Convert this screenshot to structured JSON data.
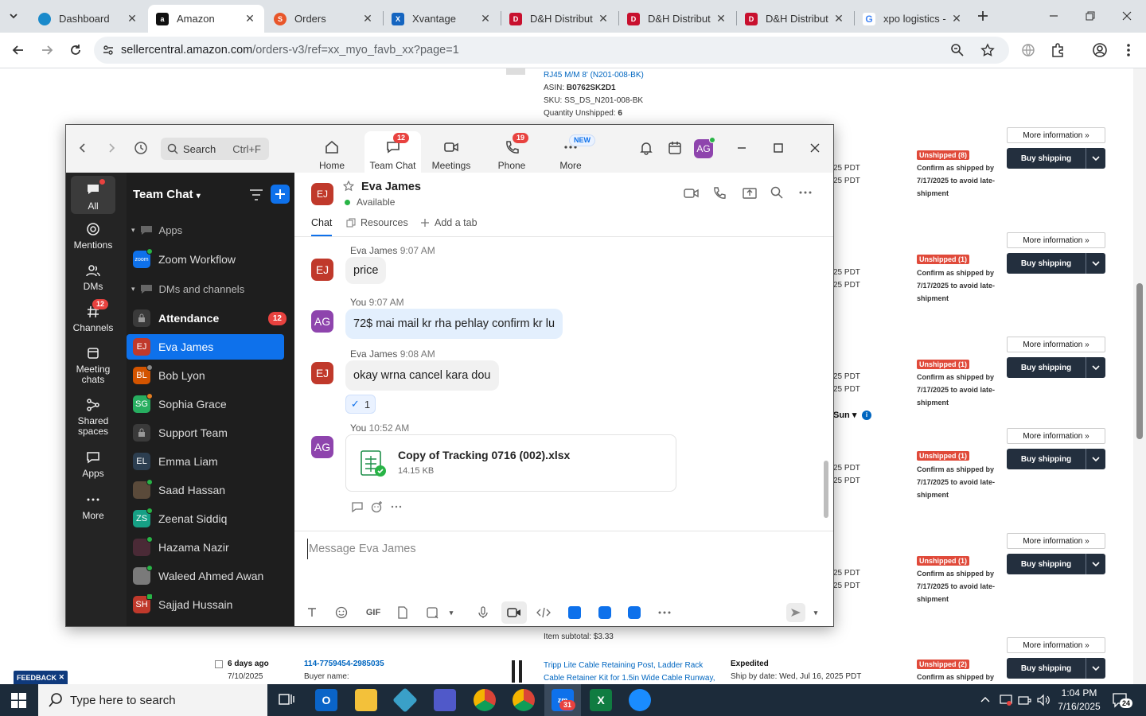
{
  "browser": {
    "tabs": [
      {
        "title": "Dashboard",
        "icon": "globe-icon"
      },
      {
        "title": "Amazon",
        "icon": "amazon-icon"
      },
      {
        "title": "Orders",
        "icon": "orders-icon"
      },
      {
        "title": "Xvantage",
        "icon": "xvantage-icon"
      },
      {
        "title": "D&H Distribut",
        "icon": "dh-icon"
      },
      {
        "title": "D&H Distribut",
        "icon": "dh-icon"
      },
      {
        "title": "D&H Distribut",
        "icon": "dh-icon"
      },
      {
        "title": "xpo logistics -",
        "icon": "google-icon"
      }
    ],
    "url_host": "sellercentral.amazon.com",
    "url_path": "/orders-v3/ref=xx_myo_favb_xx?page=1"
  },
  "page": {
    "top_item": {
      "title": "RJ45 M/M 8' (N201-008-BK)",
      "asin_label": "ASIN:",
      "asin": "B0762SK2D1",
      "sku": "SKU: SS_DS_N201-008-BK",
      "qty_label": "Quantity Unshipped:",
      "qty": "6"
    },
    "more_info": "More information »",
    "buy_shipping": "Buy shipping",
    "confirm_text": "Confirm as shipped by 7/17/2025 to avoid late-shipment",
    "pdt": "25 PDT",
    "rows": [
      {
        "status": "Unshipped (8)"
      },
      {
        "status": "Unshipped (1)"
      },
      {
        "status": "Unshipped (1)"
      },
      {
        "status": "Unshipped (1)"
      },
      {
        "status": "Unshipped (1)"
      }
    ],
    "sun_label": "Sun",
    "item_subtotal": "Item subtotal: $3.33",
    "last_row": {
      "age": "6 days ago",
      "date": "7/10/2025",
      "order_id": "114-7759454-2985035",
      "buyer_label": "Buyer name:",
      "product": "Tripp Lite Cable Retaining Post, Ladder Rack Cable Retainer Kit for 1.5in Wide Cable Runway, Straight",
      "shipping_type": "Expedited",
      "ship_by": "Ship by date: Wed, Jul 16, 2025 PDT",
      "status": "Unshipped (2)",
      "confirm_text": "Confirm as shipped by"
    },
    "feedback": "FEEDBACK"
  },
  "zoom": {
    "search_placeholder": "Search",
    "search_shortcut": "Ctrl+F",
    "nav": [
      {
        "label": "Home",
        "icon": "home-icon",
        "badge": ""
      },
      {
        "label": "Team Chat",
        "icon": "chat-icon",
        "badge": "12"
      },
      {
        "label": "Meetings",
        "icon": "video-icon",
        "badge": ""
      },
      {
        "label": "Phone",
        "icon": "phone-icon",
        "badge": "19"
      },
      {
        "label": "More",
        "icon": "more-icon",
        "badge": "NEW"
      }
    ],
    "profile_initials": "AG",
    "rail": [
      {
        "label": "All",
        "icon": "chat-bubble-icon"
      },
      {
        "label": "Mentions",
        "icon": "at-icon"
      },
      {
        "label": "DMs",
        "icon": "people-icon"
      },
      {
        "label": "Channels",
        "icon": "hash-icon",
        "badge": "12"
      },
      {
        "label": "Meeting chats",
        "icon": "calendar-icon"
      },
      {
        "label": "Shared spaces",
        "icon": "share-icon"
      },
      {
        "label": "Apps",
        "icon": "apps-icon"
      },
      {
        "label": "More",
        "icon": "more-dots-icon"
      }
    ],
    "sidebar": {
      "title": "Team Chat",
      "apps_section": "Apps",
      "dm_section": "DMs and channels",
      "zoom_workflow": "Zoom Workflow",
      "items": [
        {
          "label": "Attendance",
          "initials": "",
          "badge": "12",
          "color": "#3a3a3a"
        },
        {
          "label": "Eva James",
          "initials": "EJ",
          "badge": "",
          "color": "#c0392b"
        },
        {
          "label": "Bob Lyon",
          "initials": "BL",
          "badge": "",
          "color": "#d35400"
        },
        {
          "label": "Sophia Grace",
          "initials": "SG",
          "badge": "",
          "color": "#27ae60"
        },
        {
          "label": "Support Team",
          "initials": "",
          "badge": "",
          "color": "#3a3a3a"
        },
        {
          "label": "Emma Liam",
          "initials": "EL",
          "badge": "",
          "color": "#2c3e50"
        },
        {
          "label": "Saad Hassan",
          "initials": "",
          "badge": "",
          "color": "#5a4a3a"
        },
        {
          "label": "Zeenat Siddiq",
          "initials": "ZS",
          "badge": "",
          "color": "#16a085"
        },
        {
          "label": "Hazama Nazir",
          "initials": "",
          "badge": "",
          "color": "#4a2a36"
        },
        {
          "label": "Waleed Ahmed Awan",
          "initials": "",
          "badge": "",
          "color": "#7a7a7a"
        },
        {
          "label": "Sajjad Hussain",
          "initials": "SH",
          "badge": "",
          "color": "#c0392b"
        }
      ]
    },
    "chat": {
      "contact_name": "Eva James",
      "contact_initials": "EJ",
      "status": "Available",
      "tabs": [
        "Chat",
        "Resources",
        "Add a tab"
      ],
      "messages": [
        {
          "sender": "Eva James",
          "time": "9:07 AM",
          "text": "price",
          "initials": "EJ"
        },
        {
          "sender": "You",
          "time": "9:07 AM",
          "text": "72$ mai mail kr rha pehlay confirm kr lu",
          "initials": "AG"
        },
        {
          "sender": "Eva James",
          "time": "9:08 AM",
          "text": "okay wrna cancel kara dou",
          "initials": "EJ",
          "reaction": "✓",
          "reaction_count": "1"
        },
        {
          "sender": "You",
          "time": "10:52 AM",
          "initials": "AG",
          "file_name": "Copy of Tracking 0716 (002).xlsx",
          "file_size": "14.15 KB"
        }
      ],
      "composer_placeholder": "Message Eva James",
      "gif_label": "GIF"
    }
  },
  "taskbar": {
    "search_placeholder": "Type here to search",
    "time": "1:04 PM",
    "date": "7/16/2025",
    "notification_count": "24",
    "zoom_badge": "31"
  },
  "colors": {
    "zoom_blue": "#0e71eb",
    "amazon_navy": "#232f3e",
    "unshipped_red": "#e04a3a",
    "badge_red": "#e8423f"
  }
}
